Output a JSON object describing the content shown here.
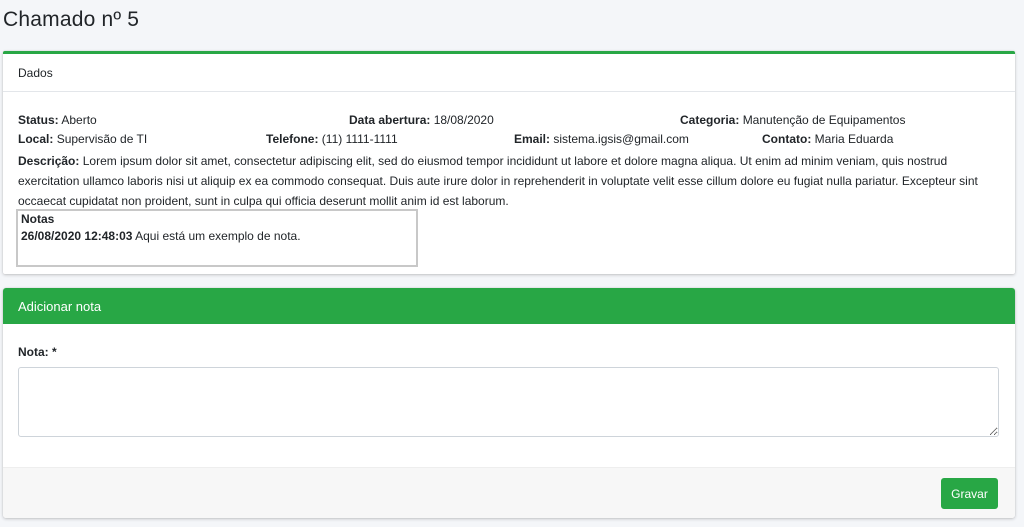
{
  "page": {
    "title": "Chamado nº 5"
  },
  "dados": {
    "header": "Dados",
    "status_label": "Status:",
    "status_value": "Aberto",
    "data_abertura_label": "Data abertura:",
    "data_abertura_value": "18/08/2020",
    "categoria_label": "Categoria:",
    "categoria_value": "Manutenção de Equipamentos",
    "local_label": "Local:",
    "local_value": "Supervisão de TI",
    "telefone_label": "Telefone:",
    "telefone_value": "(11) 1111-1111",
    "email_label": "Email:",
    "email_value": "sistema.igsis@gmail.com",
    "contato_label": "Contato:",
    "contato_value": "Maria Eduarda",
    "descricao_label": "Descrição:",
    "descricao_value": "Lorem ipsum dolor sit amet, consectetur adipiscing elit, sed do eiusmod tempor incididunt ut labore et dolore magna aliqua. Ut enim ad minim veniam, quis nostrud exercitation ullamco laboris nisi ut aliquip ex ea commodo consequat. Duis aute irure dolor in reprehenderit in voluptate velit esse cillum dolore eu fugiat nulla pariatur. Excepteur sint occaecat cupidatat non proident, sunt in culpa qui officia deserunt mollit anim id est laborum.",
    "notas_title": "Notas",
    "notas": [
      {
        "timestamp": "26/08/2020 12:48:03",
        "text": "Aqui está um exemplo de nota."
      }
    ]
  },
  "adicionar_nota": {
    "header": "Adicionar nota",
    "field_label": "Nota: *",
    "field_value": "",
    "save_label": "Gravar"
  },
  "colors": {
    "accent": "#28a745",
    "background": "#f4f6f9"
  }
}
